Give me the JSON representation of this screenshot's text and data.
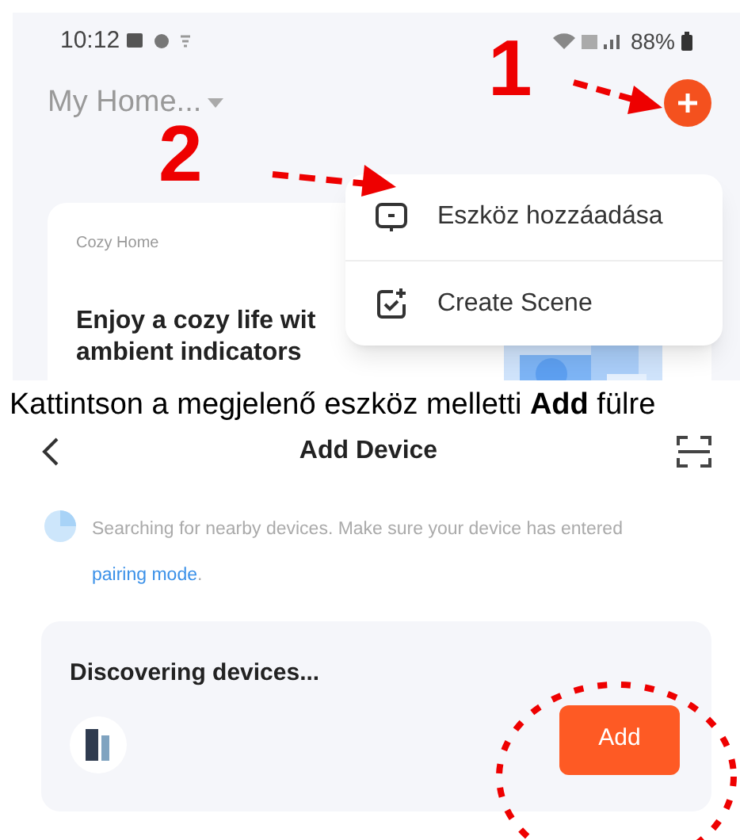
{
  "home_screen": {
    "status_bar": {
      "time": "10:12",
      "battery": "88%"
    },
    "home_selector": "My Home...",
    "card": {
      "label": "Cozy Home",
      "headline": [
        "Enjoy a cozy life wit",
        "ambient indicators"
      ]
    },
    "menu": [
      {
        "kind": "device",
        "label": "Eszköz hozzáadása"
      },
      {
        "kind": "scene",
        "label": "Create Scene"
      }
    ]
  },
  "annotations": [
    {
      "label": "1"
    },
    {
      "label": "2"
    }
  ],
  "caption": "Kattintson a megjelenő eszköz melletti **Add** fülre",
  "add_device_screen": {
    "title": "Add Device",
    "notice": "Searching for nearby devices. Make sure your device has entered ",
    "notice_link": "pairing mode",
    "notice_end": ".",
    "discovery": {
      "title": "Discovering devices...",
      "button": "Add"
    }
  }
}
